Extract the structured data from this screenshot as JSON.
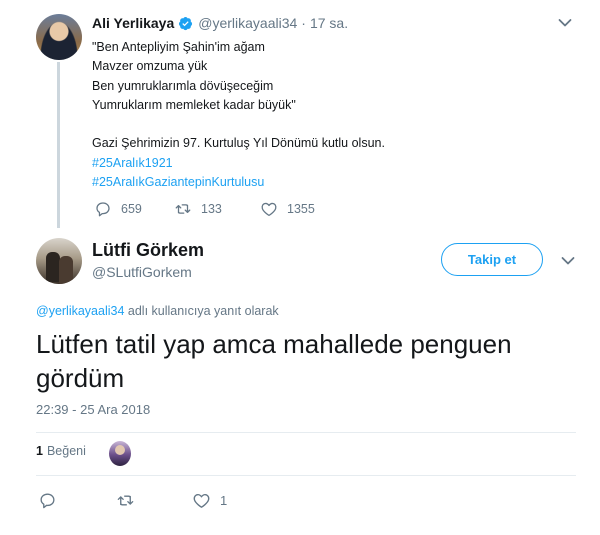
{
  "parent_tweet": {
    "author_name": "Ali Yerlikaya",
    "handle": "@yerlikayaali34",
    "separator": "·",
    "time": "17 sa.",
    "lines": [
      "\"Ben Antepliyim Şahin'im ağam",
      "Mavzer omzuma yük",
      "Ben yumruklarımla dövüşeceğim",
      "Yumruklarım memleket kadar büyük\"",
      "",
      "Gazi Şehrimizin 97. Kurtuluş Yıl Dönümü kutlu olsun."
    ],
    "hashtags": [
      "#25Aralık1921",
      "#25AralıkGaziantepinKurtulusu"
    ],
    "reply_count": "659",
    "retweet_count": "133",
    "like_count": "1355"
  },
  "main_tweet": {
    "author_name": "Lütfi Görkem",
    "handle": "@SLutfiGorkem",
    "follow_label": "Takip et",
    "reply_mention": "@yerlikayaali34",
    "reply_suffix": " adlı kullanıcıya yanıt olarak",
    "text": "Lütfen tatil yap amca mahallede penguen gördüm",
    "timestamp": "22:39 - 25 Ara 2018",
    "like_count": "1",
    "like_label": "Beğeni",
    "action_like_count": "1"
  },
  "colors": {
    "accent": "#1da1f2",
    "muted": "#657786",
    "text": "#14171a",
    "divider": "#e6ecf0",
    "thread_line": "#ccd6dd"
  },
  "icons": {
    "verified": "verified-badge-icon",
    "chevron": "chevron-down-icon",
    "reply": "reply-icon",
    "retweet": "retweet-icon",
    "like": "heart-icon"
  }
}
